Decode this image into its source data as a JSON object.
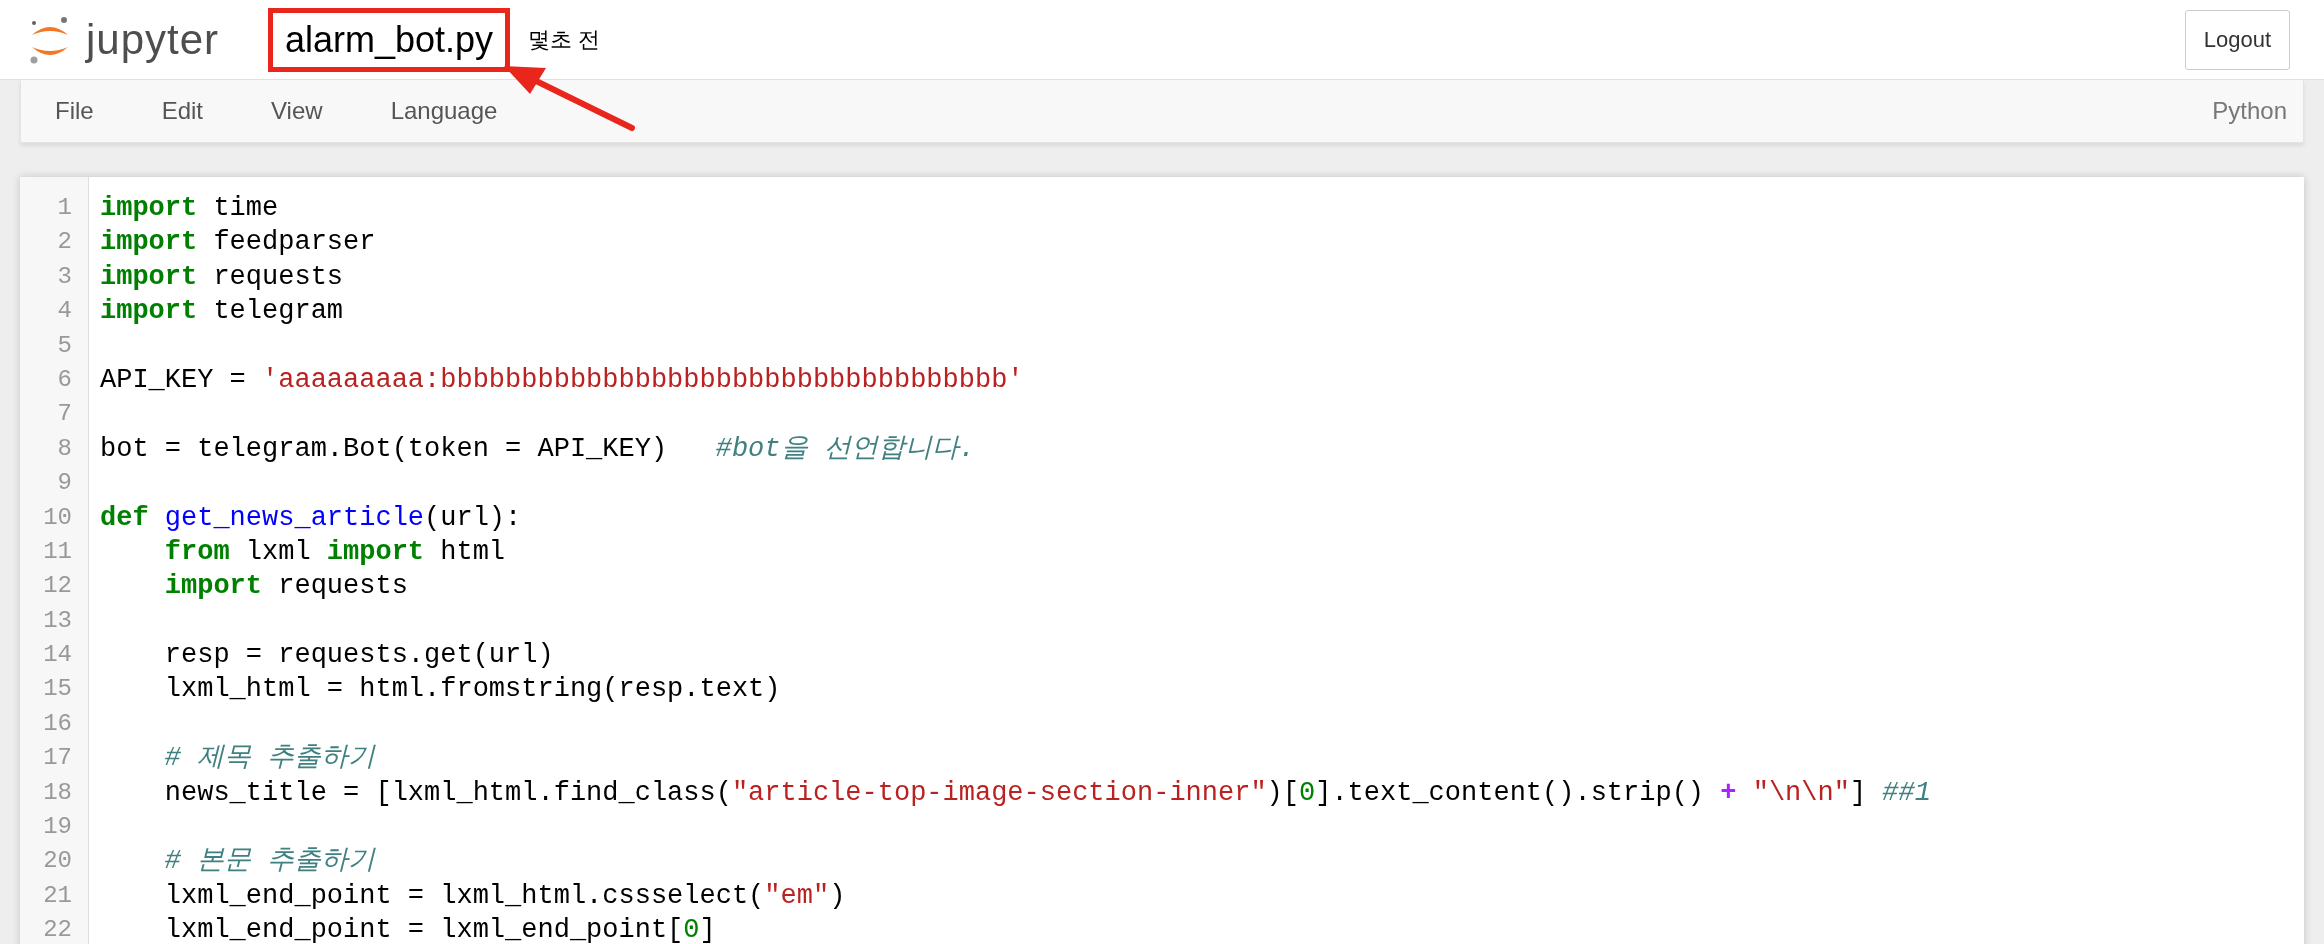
{
  "header": {
    "brand": "jupyter",
    "filename": {
      "text": "alarm_bot.py",
      "highlighted": true
    },
    "last_saved": "몇초 전",
    "logout": "Logout"
  },
  "menu": [
    "File",
    "Edit",
    "View",
    "Language"
  ],
  "language": "Python",
  "lines": [
    {
      "number": "1",
      "tokens": [
        {
          "kind": "keyword",
          "text": "import"
        },
        {
          "kind": "plain",
          "text": " time"
        }
      ]
    },
    {
      "number": "2",
      "tokens": [
        {
          "kind": "keyword",
          "text": "import"
        },
        {
          "kind": "plain",
          "text": " feedparser"
        }
      ]
    },
    {
      "number": "3",
      "tokens": [
        {
          "kind": "keyword",
          "text": "import"
        },
        {
          "kind": "plain",
          "text": " requests"
        }
      ]
    },
    {
      "number": "4",
      "tokens": [
        {
          "kind": "keyword",
          "text": "import"
        },
        {
          "kind": "plain",
          "text": " telegram"
        }
      ]
    },
    {
      "number": "5"
    },
    {
      "number": "6",
      "tokens": [
        {
          "kind": "plain",
          "text": "API_KEY = "
        },
        {
          "kind": "string",
          "text": "'aaaaaaaaa:bbbbbbbbbbbbbbbbbbbbbbbbbbbbbbbbbbb'"
        }
      ]
    },
    {
      "number": "7"
    },
    {
      "number": "8",
      "tokens": [
        {
          "kind": "plain",
          "text": "bot = telegram.Bot(token = API_KEY)   "
        },
        {
          "kind": "comment",
          "text": "#bot을 선언합니다."
        }
      ]
    },
    {
      "number": "9"
    },
    {
      "number": "10",
      "tokens": [
        {
          "kind": "keyword",
          "text": "def "
        },
        {
          "kind": "function",
          "text": "get_news_article"
        },
        {
          "kind": "plain",
          "text": "(url):"
        }
      ]
    },
    {
      "number": "11",
      "tokens": [
        {
          "kind": "keyword",
          "text": "    from"
        },
        {
          "kind": "plain",
          "text": " lxml "
        },
        {
          "kind": "keyword",
          "text": "import"
        },
        {
          "kind": "plain",
          "text": " html"
        }
      ]
    },
    {
      "number": "12",
      "tokens": [
        {
          "kind": "keyword",
          "text": "    import"
        },
        {
          "kind": "plain",
          "text": " requests"
        }
      ]
    },
    {
      "number": "13"
    },
    {
      "number": "14",
      "tokens": [
        {
          "kind": "plain",
          "text": "    resp = requests.get(url)"
        }
      ]
    },
    {
      "number": "15",
      "tokens": [
        {
          "kind": "plain",
          "text": "    lxml_html = html.fromstring(resp.text)"
        }
      ]
    },
    {
      "number": "16"
    },
    {
      "number": "17",
      "tokens": [
        {
          "kind": "comment",
          "text": "    # 제목 추출하기"
        }
      ]
    },
    {
      "number": "18",
      "tokens": [
        {
          "kind": "plain",
          "text": "    news_title = [lxml_html.find_class("
        },
        {
          "kind": "string",
          "text": "\"article-top-image-section-inner\""
        },
        {
          "kind": "plain",
          "text": ")["
        },
        {
          "kind": "number",
          "text": "0"
        },
        {
          "kind": "plain",
          "text": "].text_content().strip() "
        },
        {
          "kind": "operator",
          "text": "+"
        },
        {
          "kind": "string",
          "text": " \"\\n\\n\""
        },
        {
          "kind": "plain",
          "text": "] "
        },
        {
          "kind": "comment",
          "text": "##1"
        }
      ]
    },
    {
      "number": "19"
    },
    {
      "number": "20",
      "tokens": [
        {
          "kind": "comment",
          "text": "    # 본문 추출하기"
        }
      ]
    },
    {
      "number": "21",
      "tokens": [
        {
          "kind": "plain",
          "text": "    lxml_end_point = lxml_html.cssselect("
        },
        {
          "kind": "string",
          "text": "\"em\""
        },
        {
          "kind": "plain",
          "text": ")"
        }
      ]
    },
    {
      "number": "22",
      "tokens": [
        {
          "kind": "plain",
          "text": "    lxml_end_point = lxml_end_point["
        },
        {
          "kind": "number",
          "text": "0"
        },
        {
          "kind": "plain",
          "text": "]"
        }
      ]
    }
  ]
}
